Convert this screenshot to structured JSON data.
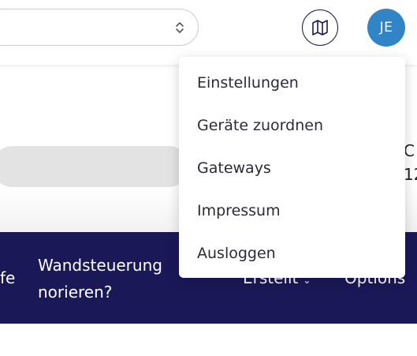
{
  "header": {
    "map_icon": "map-icon",
    "avatar_initials": "JE",
    "select_caret_icon": "chevron-up-down-icon"
  },
  "dropdown": {
    "items": [
      {
        "label": "Einstellungen"
      },
      {
        "label": "Geräte zuordnen"
      },
      {
        "label": "Gateways"
      },
      {
        "label": "Impressum"
      },
      {
        "label": "Ausloggen"
      }
    ]
  },
  "partial": {
    "right_top": "C",
    "right_bottom": "12"
  },
  "table_header": {
    "cut_left": "fe",
    "title_line1": "Wandsteuerung",
    "title_line2": "norieren?",
    "erstellt": "Erstellt",
    "options": "Options"
  },
  "colors": {
    "navy": "#1b1858",
    "avatar": "#2f85c5"
  }
}
